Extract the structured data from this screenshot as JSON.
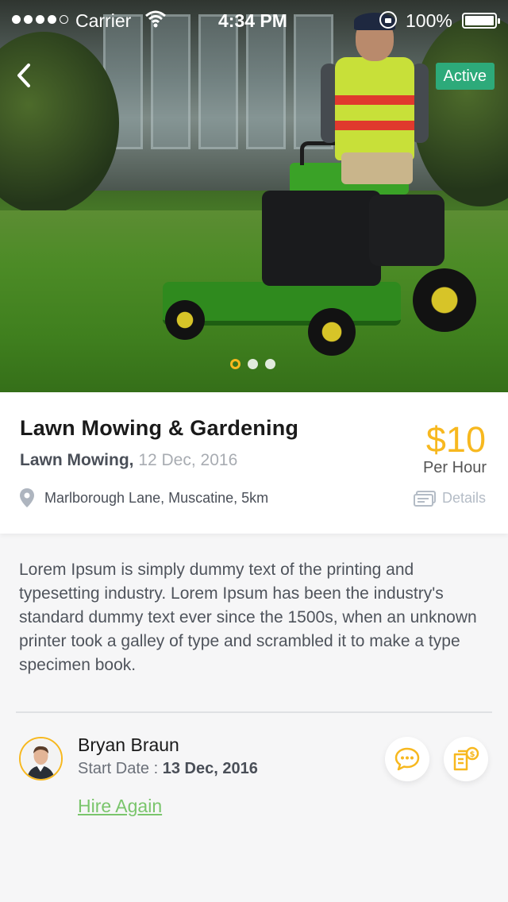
{
  "status_bar": {
    "carrier": "Carrier",
    "time": "4:34 PM",
    "battery": "100%"
  },
  "hero": {
    "status_badge": "Active",
    "carousel": {
      "slides": 3,
      "active_index": 0
    }
  },
  "job": {
    "title": "Lawn Mowing & Gardening",
    "category": "Lawn Mowing,",
    "date": "12 Dec, 2016",
    "location": "Marlborough Lane, Muscatine, 5km",
    "price": "$10",
    "price_unit": "Per Hour",
    "details_label": "Details"
  },
  "description": "Lorem Ipsum is simply dummy text of the printing and typesetting industry. Lorem Ipsum has been the industry's standard dummy text ever since the 1500s, when an unknown printer took a galley of type and scrambled it to make a type specimen book.",
  "provider": {
    "name": "Bryan Braun",
    "start_label": "Start Date :",
    "start_date": "13 Dec, 2016",
    "hire_again_label": "Hire Again"
  },
  "colors": {
    "accent": "#f7b81f",
    "active_badge": "#2daa7a",
    "hire_link": "#7ac56c"
  },
  "icons": {
    "back": "back-chevron-icon",
    "location": "location-pin-icon",
    "details": "ticket-icon",
    "chat": "chat-bubble-icon",
    "payment": "invoice-dollar-icon"
  }
}
